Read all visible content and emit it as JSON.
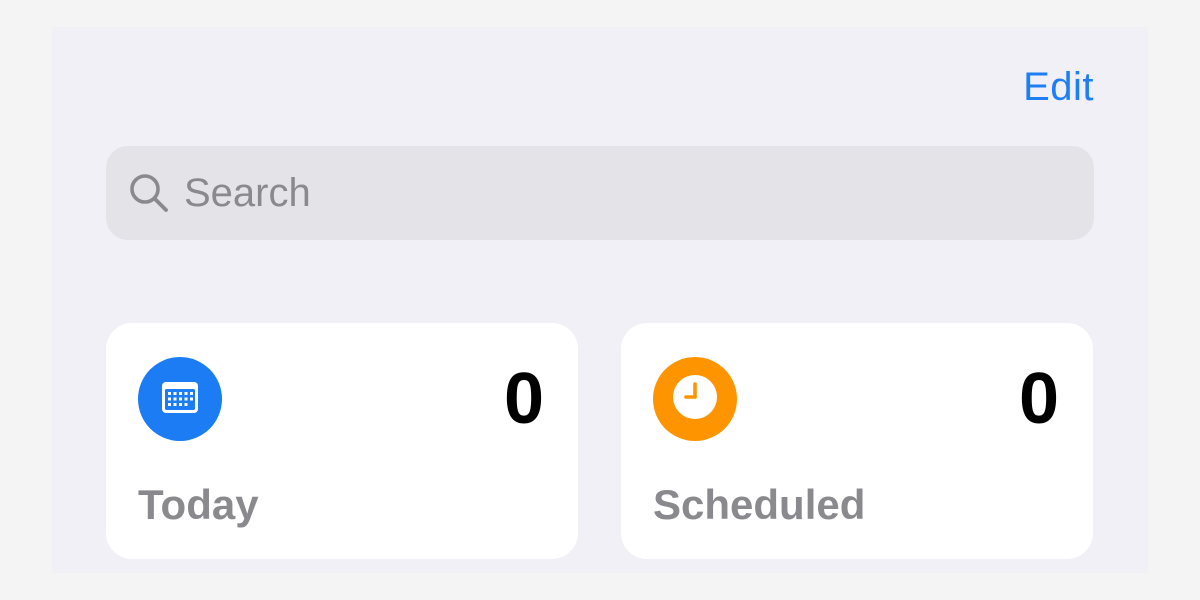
{
  "header": {
    "edit_label": "Edit"
  },
  "search": {
    "placeholder": "Search",
    "icon": "magnifying-glass"
  },
  "smart_lists": [
    {
      "label": "Today",
      "count": "0",
      "icon": "calendar-icon",
      "color": "#1b7cf4"
    },
    {
      "label": "Scheduled",
      "count": "0",
      "icon": "clock-icon",
      "color": "#fe9500"
    }
  ],
  "colors": {
    "accent": "#1e7ef3",
    "background": "#f1f0f6",
    "search_fill": "#e3e3e8",
    "secondary_text": "#8a8a8e"
  }
}
